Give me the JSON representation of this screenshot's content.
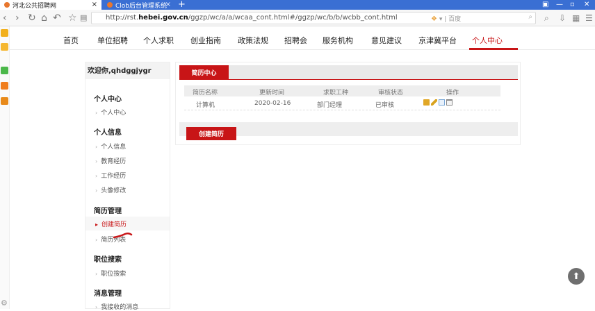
{
  "browser": {
    "tabs": [
      {
        "label": "河北公共招聘网",
        "close": "×"
      },
      {
        "label": "Clob后台管理系统",
        "close": "×"
      }
    ],
    "new_tab": "+",
    "window_controls": [
      "▣",
      "—",
      "▫",
      "✕"
    ],
    "url_host_prefix": "http://rst.",
    "url_host_bold": "hebei.gov.cn",
    "url_path": "/ggzp/wc/a/a/wcaa_cont.html#/ggzp/wc/b/b/wcbb_cont.html",
    "search_engine_label": "百度"
  },
  "site_nav": {
    "items": [
      "首页",
      "单位招聘",
      "个人求职",
      "创业指南",
      "政策法规",
      "招聘会",
      "服务机构",
      "意见建议",
      "京津冀平台",
      "个人中心"
    ],
    "active_index": 9
  },
  "sidebar": {
    "welcome": "欢迎你,qhdggjygr",
    "sections": [
      {
        "title": "个人中心",
        "links": [
          "个人中心"
        ]
      },
      {
        "title": "个人信息",
        "links": [
          "个人信息",
          "教育经历",
          "工作经历",
          "头像修改"
        ]
      },
      {
        "title": "简历管理",
        "links": [
          "创建简历",
          "简历列表"
        ]
      },
      {
        "title": "职位搜索",
        "links": [
          "职位搜索"
        ]
      },
      {
        "title": "消息管理",
        "links": [
          "我接收的消息"
        ]
      }
    ],
    "active_link": "创建简历"
  },
  "main": {
    "tab_label": "简历中心",
    "table": {
      "headers": [
        "简历名称",
        "更新时间",
        "求职工种",
        "审核状态",
        "操作"
      ],
      "rows": [
        {
          "name": "计算机",
          "updated": "2020-02-16",
          "job_type": "部门经理",
          "status": "已审核"
        }
      ]
    },
    "create_button": "创建简历"
  },
  "colors": {
    "accent": "#c81517",
    "browser_blue": "#3a6fd3"
  }
}
